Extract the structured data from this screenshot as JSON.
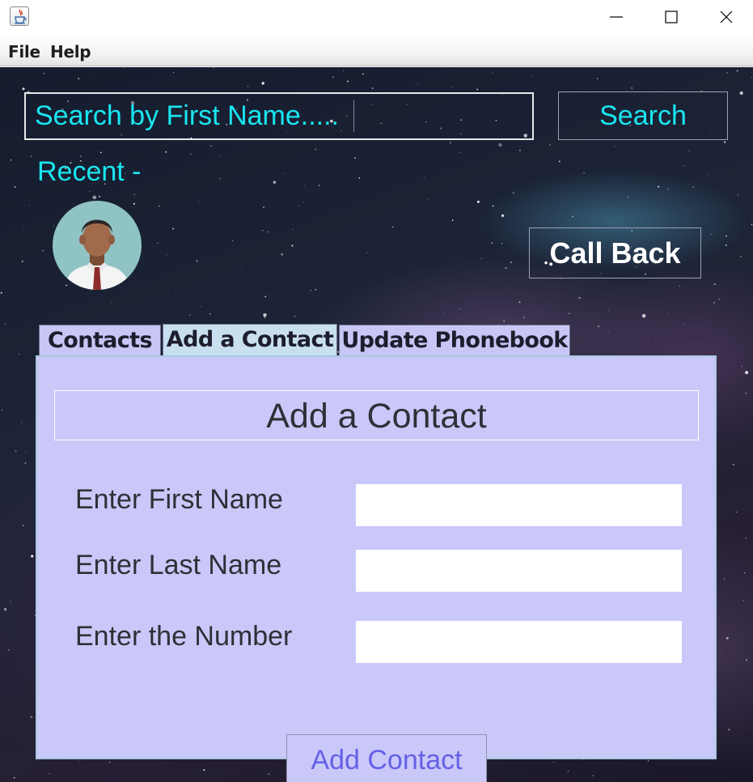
{
  "window": {
    "title": "",
    "controls": [
      "minimize-icon",
      "maximize-icon",
      "close-icon"
    ]
  },
  "menu": {
    "items": [
      {
        "label": "File"
      },
      {
        "label": "Help"
      }
    ]
  },
  "search": {
    "placeholder": "Search by First Name.....",
    "button_label": "Search"
  },
  "recent": {
    "label": "Recent -",
    "avatar_icon": "person-avatar-icon"
  },
  "callback": {
    "label": "Call Back"
  },
  "tabs": [
    {
      "label": "Contacts",
      "selected": false
    },
    {
      "label": "Add a Contact",
      "selected": true
    },
    {
      "label": "Update Phonebook",
      "selected": false
    }
  ],
  "form": {
    "title": "Add a Contact",
    "first_name_label": "Enter First Name",
    "first_name_value": "",
    "last_name_label": "Enter Last Name",
    "last_name_value": "",
    "number_label": "Enter the Number",
    "number_value": "",
    "submit_label": "Add Contact"
  },
  "colors": {
    "accent_cyan": "#19e6f0",
    "panel_bg": "#cac8f9",
    "selected_tab_bg": "#c8dfef",
    "submit_text": "#6461e6"
  }
}
